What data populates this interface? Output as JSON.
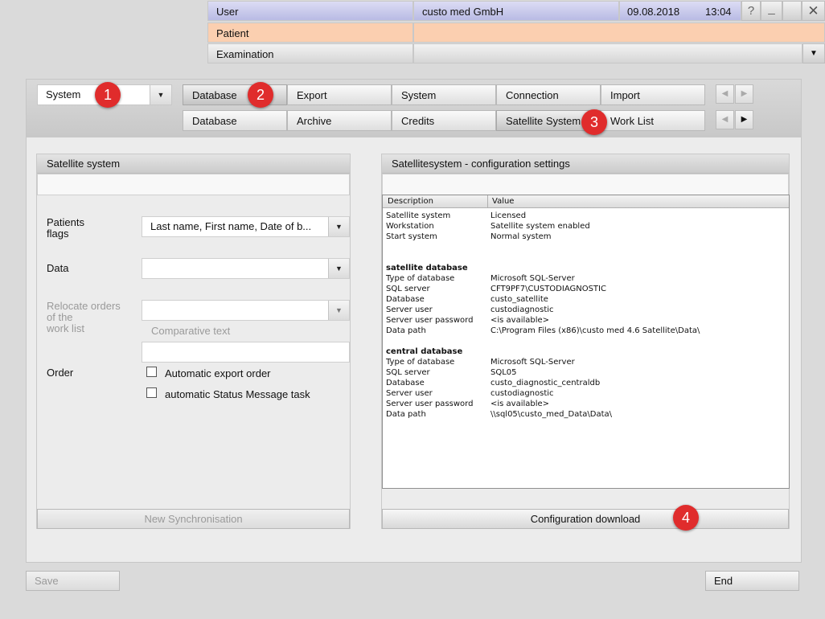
{
  "header": {
    "user_label": "User",
    "company": "custo med GmbH",
    "date": "09.08.2018",
    "time": "13:04",
    "patient_label": "Patient",
    "examination_label": "Examination",
    "help_glyph": "?",
    "minimize_glyph": "_",
    "close_glyph": "✕"
  },
  "toolbar": {
    "module_select": "System",
    "tabs_row1": [
      "Database",
      "Export",
      "System",
      "Connection",
      "Import"
    ],
    "tabs_row2": [
      "Database",
      "Archive",
      "Credits",
      "Satellite System",
      "Work List"
    ]
  },
  "badges": [
    "1",
    "2",
    "3",
    "4"
  ],
  "left_panel": {
    "title": "Satellite system",
    "patients_flags_label": "Patients\nflags",
    "patients_flags_value": "Last name, First name, Date of b...",
    "data_label": "Data",
    "data_value": "",
    "relocate_label": "Relocate orders\nof the\nwork list",
    "relocate_value": "",
    "comparative_text_label": "Comparative text",
    "comparative_text_value": "",
    "order_label": "Order",
    "checkbox_export": "Automatic export order",
    "checkbox_status": "automatic Status Message task",
    "sync_button": "New Synchronisation"
  },
  "right_panel": {
    "title": "Satellitesystem - configuration settings",
    "col_description": "Description",
    "col_value": "Value",
    "rows": [
      {
        "d": "Satellite system",
        "v": "Licensed",
        "b": false
      },
      {
        "d": "Workstation",
        "v": "Satellite system enabled",
        "b": false
      },
      {
        "d": "Start system",
        "v": "Normal system",
        "b": false
      },
      {
        "d": "",
        "v": "",
        "b": false
      },
      {
        "d": "",
        "v": "",
        "b": false
      },
      {
        "d": "satellite database",
        "v": "",
        "b": true
      },
      {
        "d": "Type of database",
        "v": "Microsoft SQL-Server",
        "b": false
      },
      {
        "d": "SQL server",
        "v": "CFT9PF7\\CUSTODIAGNOSTIC",
        "b": false
      },
      {
        "d": "Database",
        "v": "custo_satellite",
        "b": false
      },
      {
        "d": "Server user",
        "v": "custodiagnostic",
        "b": false
      },
      {
        "d": "Server user password",
        "v": "<is available>",
        "b": false
      },
      {
        "d": "Data path",
        "v": "C:\\Program Files (x86)\\custo med 4.6 Satellite\\Data\\",
        "b": false
      },
      {
        "d": "",
        "v": "",
        "b": false
      },
      {
        "d": "central database",
        "v": "",
        "b": true
      },
      {
        "d": "Type of database",
        "v": "Microsoft SQL-Server",
        "b": false
      },
      {
        "d": "SQL server",
        "v": "SQL05",
        "b": false
      },
      {
        "d": "Database",
        "v": "custo_diagnostic_centraldb",
        "b": false
      },
      {
        "d": "Server user",
        "v": "custodiagnostic",
        "b": false
      },
      {
        "d": "Server user password",
        "v": "<is available>",
        "b": false
      },
      {
        "d": "Data path",
        "v": "\\\\sql05\\custo_med_Data\\Data\\",
        "b": false
      }
    ],
    "download_button": "Configuration download"
  },
  "footer": {
    "save_button": "Save",
    "end_button": "End"
  },
  "colors": {
    "badge": "#e02c2c",
    "user_row": "#c4c6ea",
    "patient_row": "#fbcfb0"
  }
}
